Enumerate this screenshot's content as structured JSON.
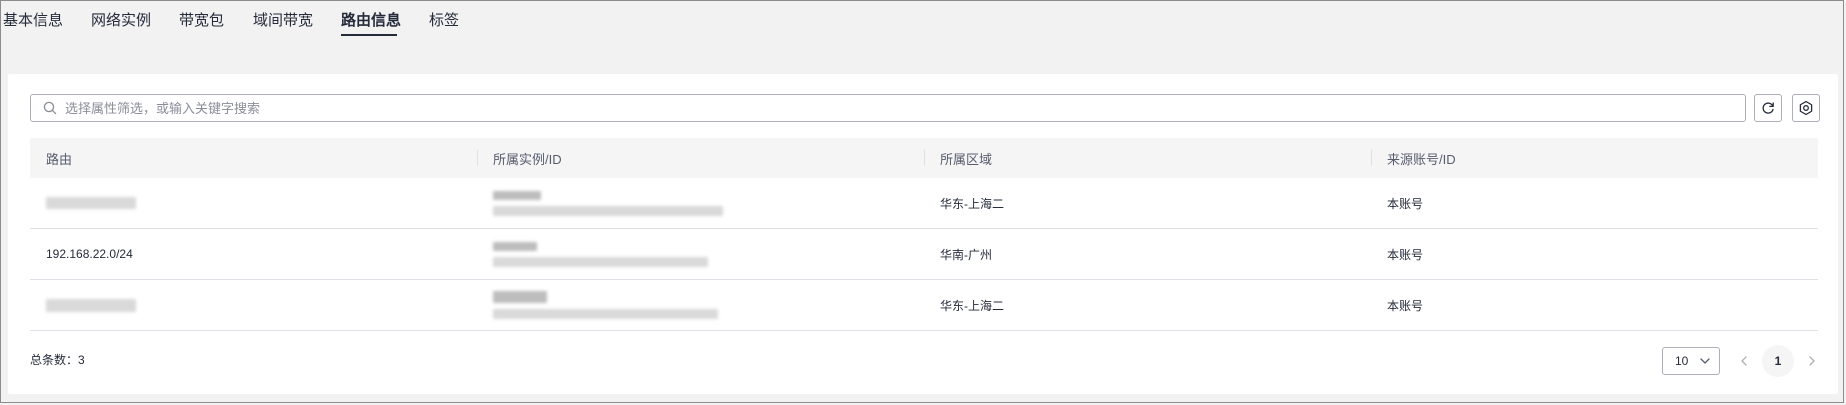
{
  "tabs": [
    {
      "label": "基本信息"
    },
    {
      "label": "网络实例"
    },
    {
      "label": "带宽包"
    },
    {
      "label": "域间带宽"
    },
    {
      "label": "路由信息",
      "active": true
    },
    {
      "label": "标签"
    }
  ],
  "search": {
    "placeholder": "选择属性筛选，或输入关键字搜索",
    "value": ""
  },
  "toolbar": {
    "refresh_icon": "refresh-icon",
    "settings_icon": "settings-icon"
  },
  "table": {
    "columns": [
      "路由",
      "所属实例/ID",
      "所属区域",
      "来源账号/ID"
    ],
    "rows": [
      {
        "route": "",
        "route_redacted": true,
        "instance_redacted": true,
        "region": "华东-上海二",
        "account": "本账号"
      },
      {
        "route": "192.168.22.0/24",
        "route_redacted": false,
        "instance_redacted": true,
        "region": "华南-广州",
        "account": "本账号"
      },
      {
        "route": "",
        "route_redacted": true,
        "instance_redacted": true,
        "region": "华东-上海二",
        "account": "本账号"
      }
    ]
  },
  "footer": {
    "total_label": "总条数：3",
    "page_size": "10",
    "current_page": "1"
  },
  "colors": {
    "active_tab": "#252b3a",
    "border": "#adb0b8",
    "header_bg": "#f5f5f6"
  }
}
